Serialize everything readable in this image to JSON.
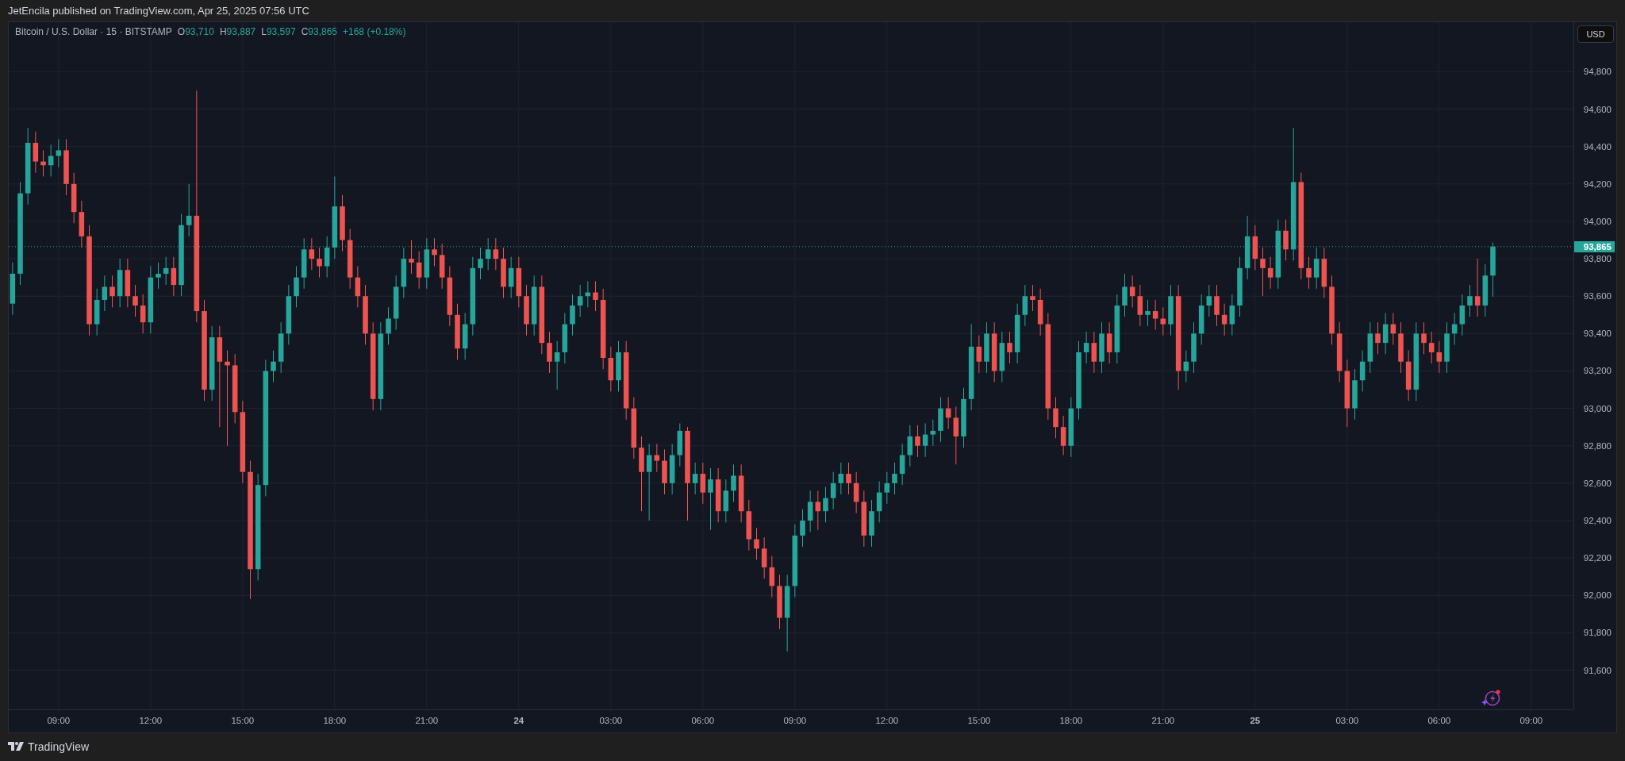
{
  "header": {
    "text": "JetEncila published on TradingView.com, Apr 25, 2025 07:56 UTC"
  },
  "chart": {
    "legend": {
      "symbol": "Bitcoin / U.S. Dollar · 15 · BITSTAMP",
      "ohlc": [
        {
          "label": "O",
          "value": "93,710"
        },
        {
          "label": "H",
          "value": "93,887"
        },
        {
          "label": "L",
          "value": "93,597"
        },
        {
          "label": "C",
          "value": "93,865"
        }
      ],
      "change": "+168 (+0.18%)"
    },
    "currency": "USD",
    "last_price_label": "93,865",
    "chart_data": {
      "type": "candlestick",
      "ylim": [
        91390,
        95065
      ],
      "grid": true,
      "ref_lines": [
        {
          "axis": "y",
          "value": 93865
        }
      ],
      "yticks": [
        {
          "value": 91600,
          "label": "91,600"
        },
        {
          "value": 91800,
          "label": "91,800"
        },
        {
          "value": 92000,
          "label": "92,000"
        },
        {
          "value": 92200,
          "label": "92,200"
        },
        {
          "value": 92400,
          "label": "92,400"
        },
        {
          "value": 92600,
          "label": "92,600"
        },
        {
          "value": 92800,
          "label": "92,800"
        },
        {
          "value": 93000,
          "label": "93,000"
        },
        {
          "value": 93200,
          "label": "93,200"
        },
        {
          "value": 93400,
          "label": "93,400"
        },
        {
          "value": 93600,
          "label": "93,600"
        },
        {
          "value": 93800,
          "label": "93,800"
        },
        {
          "value": 94000,
          "label": "94,000"
        },
        {
          "value": 94200,
          "label": "94,200"
        },
        {
          "value": 94400,
          "label": "94,400"
        },
        {
          "value": 94600,
          "label": "94,600"
        },
        {
          "value": 94800,
          "label": "94,800"
        }
      ],
      "categories": [
        null,
        null,
        null,
        null,
        null,
        null,
        "09:00",
        null,
        null,
        null,
        null,
        null,
        null,
        null,
        null,
        null,
        null,
        null,
        "12:00",
        null,
        null,
        null,
        null,
        null,
        null,
        null,
        null,
        null,
        null,
        null,
        "15:00",
        null,
        null,
        null,
        null,
        null,
        null,
        null,
        null,
        null,
        null,
        null,
        "18:00",
        null,
        null,
        null,
        null,
        null,
        null,
        null,
        null,
        null,
        null,
        null,
        "21:00",
        null,
        null,
        null,
        null,
        null,
        null,
        null,
        null,
        null,
        null,
        null,
        "24",
        null,
        null,
        null,
        null,
        null,
        null,
        null,
        null,
        null,
        null,
        null,
        "03:00",
        null,
        null,
        null,
        null,
        null,
        null,
        null,
        null,
        null,
        null,
        null,
        "06:00",
        null,
        null,
        null,
        null,
        null,
        null,
        null,
        null,
        null,
        null,
        null,
        "09:00",
        null,
        null,
        null,
        null,
        null,
        null,
        null,
        null,
        null,
        null,
        null,
        "12:00",
        null,
        null,
        null,
        null,
        null,
        null,
        null,
        null,
        null,
        null,
        null,
        "15:00",
        null,
        null,
        null,
        null,
        null,
        null,
        null,
        null,
        null,
        null,
        null,
        "18:00",
        null,
        null,
        null,
        null,
        null,
        null,
        null,
        null,
        null,
        null,
        null,
        "21:00",
        null,
        null,
        null,
        null,
        null,
        null,
        null,
        null,
        null,
        null,
        null,
        "25",
        null,
        null,
        null,
        null,
        null,
        null,
        null,
        null,
        null,
        null,
        null,
        "03:00",
        null,
        null,
        null,
        null,
        null,
        null,
        null,
        null,
        null,
        null,
        null,
        "06:00",
        null,
        null,
        null,
        null,
        null,
        null,
        null,
        null,
        null,
        null,
        null,
        "09:00"
      ],
      "ohlc": [
        [
          93560,
          93780,
          93500,
          93720
        ],
        [
          93720,
          94210,
          93660,
          94150
        ],
        [
          94150,
          94500,
          94090,
          94420
        ],
        [
          94420,
          94480,
          94260,
          94320
        ],
        [
          94320,
          94380,
          94240,
          94300
        ],
        [
          94300,
          94410,
          94240,
          94350
        ],
        [
          94350,
          94440,
          94290,
          94380
        ],
        [
          94380,
          94440,
          94140,
          94200
        ],
        [
          94200,
          94260,
          93990,
          94050
        ],
        [
          94050,
          94110,
          93860,
          93920
        ],
        [
          93920,
          93980,
          93390,
          93450
        ],
        [
          93450,
          93640,
          93390,
          93580
        ],
        [
          93580,
          93710,
          93520,
          93650
        ],
        [
          93650,
          93710,
          93540,
          93600
        ],
        [
          93600,
          93800,
          93540,
          93740
        ],
        [
          93740,
          93800,
          93540,
          93600
        ],
        [
          93600,
          93660,
          93490,
          93550
        ],
        [
          93550,
          93610,
          93400,
          93460
        ],
        [
          93460,
          93760,
          93400,
          93700
        ],
        [
          93700,
          93780,
          93640,
          93720
        ],
        [
          93720,
          93810,
          93660,
          93750
        ],
        [
          93750,
          93810,
          93600,
          93660
        ],
        [
          93660,
          94040,
          93600,
          93980
        ],
        [
          93980,
          94200,
          93920,
          94030
        ],
        [
          94030,
          94700,
          93460,
          93520
        ],
        [
          93520,
          93580,
          93040,
          93100
        ],
        [
          93100,
          93440,
          93040,
          93380
        ],
        [
          93380,
          93440,
          92900,
          93250
        ],
        [
          93250,
          93310,
          92800,
          93230
        ],
        [
          93230,
          93290,
          92920,
          92980
        ],
        [
          92980,
          93040,
          92600,
          92660
        ],
        [
          92660,
          92720,
          91980,
          92140
        ],
        [
          92140,
          92650,
          92080,
          92590
        ],
        [
          92590,
          93260,
          92530,
          93200
        ],
        [
          93200,
          93310,
          93140,
          93250
        ],
        [
          93250,
          93460,
          93190,
          93400
        ],
        [
          93400,
          93660,
          93340,
          93600
        ],
        [
          93600,
          93760,
          93540,
          93700
        ],
        [
          93700,
          93910,
          93640,
          93850
        ],
        [
          93850,
          93910,
          93740,
          93800
        ],
        [
          93800,
          93860,
          93700,
          93760
        ],
        [
          93760,
          93920,
          93700,
          93860
        ],
        [
          93860,
          94240,
          93800,
          94080
        ],
        [
          94080,
          94140,
          93840,
          93900
        ],
        [
          93900,
          93960,
          93640,
          93700
        ],
        [
          93700,
          93760,
          93540,
          93600
        ],
        [
          93600,
          93660,
          93340,
          93400
        ],
        [
          93400,
          93460,
          92990,
          93050
        ],
        [
          93050,
          93460,
          92990,
          93400
        ],
        [
          93400,
          93540,
          93340,
          93480
        ],
        [
          93480,
          93710,
          93420,
          93650
        ],
        [
          93650,
          93860,
          93590,
          93800
        ],
        [
          93800,
          93900,
          93720,
          93780
        ],
        [
          93780,
          93840,
          93640,
          93700
        ],
        [
          93700,
          93910,
          93640,
          93850
        ],
        [
          93850,
          93910,
          93760,
          93820
        ],
        [
          93820,
          93880,
          93640,
          93700
        ],
        [
          93700,
          93760,
          93440,
          93500
        ],
        [
          93500,
          93560,
          93260,
          93320
        ],
        [
          93320,
          93510,
          93260,
          93450
        ],
        [
          93450,
          93810,
          93390,
          93750
        ],
        [
          93750,
          93860,
          93690,
          93800
        ],
        [
          93800,
          93910,
          93740,
          93850
        ],
        [
          93850,
          93910,
          93740,
          93800
        ],
        [
          93800,
          93860,
          93590,
          93650
        ],
        [
          93650,
          93810,
          93590,
          93750
        ],
        [
          93750,
          93810,
          93540,
          93600
        ],
        [
          93600,
          93660,
          93390,
          93450
        ],
        [
          93450,
          93710,
          93390,
          93650
        ],
        [
          93650,
          93710,
          93290,
          93350
        ],
        [
          93350,
          93410,
          93190,
          93250
        ],
        [
          93250,
          93360,
          93100,
          93300
        ],
        [
          93300,
          93510,
          93240,
          93450
        ],
        [
          93450,
          93610,
          93390,
          93550
        ],
        [
          93550,
          93660,
          93490,
          93600
        ],
        [
          93600,
          93680,
          93540,
          93620
        ],
        [
          93620,
          93680,
          93520,
          93580
        ],
        [
          93580,
          93640,
          93210,
          93270
        ],
        [
          93270,
          93330,
          93090,
          93150
        ],
        [
          93150,
          93360,
          93090,
          93300
        ],
        [
          93300,
          93360,
          92940,
          93000
        ],
        [
          93000,
          93060,
          92730,
          92790
        ],
        [
          92790,
          92850,
          92450,
          92660
        ],
        [
          92660,
          92810,
          92400,
          92750
        ],
        [
          92750,
          92810,
          92660,
          92720
        ],
        [
          92720,
          92780,
          92540,
          92600
        ],
        [
          92600,
          92810,
          92540,
          92750
        ],
        [
          92750,
          92920,
          92690,
          92880
        ],
        [
          92880,
          92900,
          92400,
          92600
        ],
        [
          92600,
          92710,
          92540,
          92650
        ],
        [
          92650,
          92710,
          92490,
          92550
        ],
        [
          92550,
          92680,
          92350,
          92620
        ],
        [
          92620,
          92680,
          92390,
          92450
        ],
        [
          92450,
          92620,
          92390,
          92560
        ],
        [
          92560,
          92700,
          92500,
          92640
        ],
        [
          92640,
          92700,
          92390,
          92450
        ],
        [
          92450,
          92510,
          92240,
          92300
        ],
        [
          92300,
          92360,
          92190,
          92250
        ],
        [
          92250,
          92310,
          92090,
          92150
        ],
        [
          92150,
          92210,
          91990,
          92050
        ],
        [
          92050,
          92110,
          91820,
          91880
        ],
        [
          91880,
          92110,
          91700,
          92050
        ],
        [
          92050,
          92380,
          91990,
          92320
        ],
        [
          92320,
          92460,
          92260,
          92400
        ],
        [
          92400,
          92560,
          92340,
          92500
        ],
        [
          92500,
          92560,
          92350,
          92450
        ],
        [
          92450,
          92580,
          92390,
          92520
        ],
        [
          92520,
          92660,
          92460,
          92600
        ],
        [
          92600,
          92710,
          92540,
          92650
        ],
        [
          92650,
          92710,
          92540,
          92600
        ],
        [
          92600,
          92660,
          92440,
          92500
        ],
        [
          92500,
          92560,
          92260,
          92320
        ],
        [
          92320,
          92510,
          92260,
          92450
        ],
        [
          92450,
          92610,
          92390,
          92550
        ],
        [
          92550,
          92660,
          92490,
          92600
        ],
        [
          92600,
          92710,
          92540,
          92650
        ],
        [
          92650,
          92810,
          92590,
          92750
        ],
        [
          92750,
          92910,
          92690,
          92850
        ],
        [
          92850,
          92910,
          92740,
          92800
        ],
        [
          92800,
          92920,
          92740,
          92860
        ],
        [
          92860,
          92940,
          92800,
          92880
        ],
        [
          92880,
          93060,
          92820,
          93000
        ],
        [
          93000,
          93060,
          92890,
          92950
        ],
        [
          92950,
          93010,
          92700,
          92850
        ],
        [
          92850,
          93110,
          92790,
          93050
        ],
        [
          93050,
          93450,
          92990,
          93330
        ],
        [
          93330,
          93390,
          93190,
          93250
        ],
        [
          93250,
          93460,
          93190,
          93400
        ],
        [
          93400,
          93460,
          93140,
          93200
        ],
        [
          93200,
          93410,
          93140,
          93350
        ],
        [
          93350,
          93410,
          93240,
          93300
        ],
        [
          93300,
          93560,
          93240,
          93500
        ],
        [
          93500,
          93660,
          93440,
          93600
        ],
        [
          93600,
          93660,
          93520,
          93580
        ],
        [
          93580,
          93640,
          93390,
          93450
        ],
        [
          93450,
          93510,
          92940,
          93000
        ],
        [
          93000,
          93060,
          92840,
          92900
        ],
        [
          92900,
          92960,
          92750,
          92800
        ],
        [
          92800,
          93060,
          92740,
          93000
        ],
        [
          93000,
          93360,
          92940,
          93300
        ],
        [
          93300,
          93410,
          93240,
          93350
        ],
        [
          93350,
          93410,
          93190,
          93250
        ],
        [
          93250,
          93460,
          93190,
          93400
        ],
        [
          93400,
          93460,
          93240,
          93300
        ],
        [
          93300,
          93610,
          93240,
          93550
        ],
        [
          93550,
          93720,
          93490,
          93650
        ],
        [
          93650,
          93710,
          93540,
          93600
        ],
        [
          93600,
          93660,
          93440,
          93500
        ],
        [
          93500,
          93580,
          93440,
          93520
        ],
        [
          93520,
          93580,
          93420,
          93480
        ],
        [
          93480,
          93540,
          93390,
          93450
        ],
        [
          93450,
          93660,
          93390,
          93600
        ],
        [
          93600,
          93660,
          93100,
          93200
        ],
        [
          93200,
          93310,
          93140,
          93250
        ],
        [
          93250,
          93460,
          93190,
          93400
        ],
        [
          93400,
          93610,
          93340,
          93550
        ],
        [
          93550,
          93660,
          93490,
          93600
        ],
        [
          93600,
          93660,
          93440,
          93500
        ],
        [
          93500,
          93560,
          93390,
          93450
        ],
        [
          93450,
          93610,
          93390,
          93550
        ],
        [
          93550,
          93810,
          93490,
          93750
        ],
        [
          93750,
          94030,
          93690,
          93920
        ],
        [
          93920,
          93980,
          93740,
          93800
        ],
        [
          93800,
          93860,
          93600,
          93750
        ],
        [
          93750,
          93810,
          93640,
          93700
        ],
        [
          93700,
          94010,
          93640,
          93950
        ],
        [
          93950,
          94010,
          93790,
          93850
        ],
        [
          93850,
          94500,
          93790,
          94210
        ],
        [
          94210,
          94260,
          93690,
          93750
        ],
        [
          93750,
          93810,
          93640,
          93700
        ],
        [
          93700,
          93860,
          93640,
          93800
        ],
        [
          93800,
          93860,
          93590,
          93650
        ],
        [
          93650,
          93710,
          93340,
          93400
        ],
        [
          93400,
          93460,
          93140,
          93200
        ],
        [
          93200,
          93260,
          92900,
          93000
        ],
        [
          93000,
          93210,
          92940,
          93150
        ],
        [
          93150,
          93310,
          93090,
          93250
        ],
        [
          93250,
          93460,
          93190,
          93400
        ],
        [
          93400,
          93460,
          93290,
          93350
        ],
        [
          93350,
          93510,
          93290,
          93450
        ],
        [
          93450,
          93510,
          93340,
          93400
        ],
        [
          93400,
          93460,
          93190,
          93250
        ],
        [
          93250,
          93310,
          93040,
          93100
        ],
        [
          93100,
          93460,
          93040,
          93400
        ],
        [
          93400,
          93460,
          93290,
          93350
        ],
        [
          93350,
          93410,
          93240,
          93300
        ],
        [
          93300,
          93360,
          93190,
          93250
        ],
        [
          93250,
          93460,
          93190,
          93400
        ],
        [
          93400,
          93510,
          93340,
          93450
        ],
        [
          93450,
          93610,
          93390,
          93550
        ],
        [
          93550,
          93660,
          93490,
          93600
        ],
        [
          93600,
          93800,
          93490,
          93550
        ],
        [
          93550,
          93770,
          93490,
          93710
        ],
        [
          93710,
          93887,
          93597,
          93865
        ],
        null,
        null,
        null,
        null,
        null
      ]
    }
  },
  "footer": {
    "brand": "TradingView"
  }
}
